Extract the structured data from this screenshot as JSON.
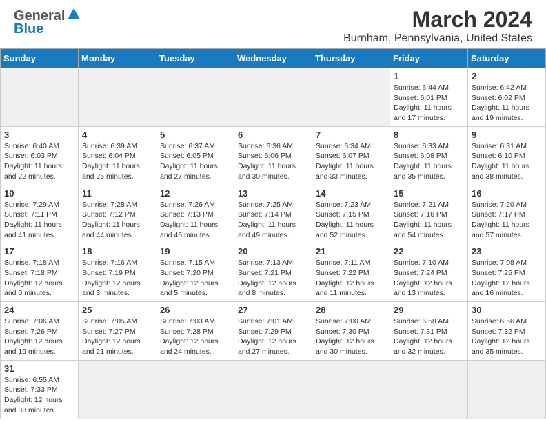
{
  "title": "March 2024",
  "subtitle": "Burnham, Pennsylvania, United States",
  "logo": {
    "text_general": "General",
    "text_blue": "Blue"
  },
  "days_of_week": [
    "Sunday",
    "Monday",
    "Tuesday",
    "Wednesday",
    "Thursday",
    "Friday",
    "Saturday"
  ],
  "weeks": [
    [
      {
        "day": "",
        "detail": ""
      },
      {
        "day": "",
        "detail": ""
      },
      {
        "day": "",
        "detail": ""
      },
      {
        "day": "",
        "detail": ""
      },
      {
        "day": "",
        "detail": ""
      },
      {
        "day": "1",
        "detail": "Sunrise: 6:44 AM\nSunset: 6:01 PM\nDaylight: 11 hours\nand 17 minutes."
      },
      {
        "day": "2",
        "detail": "Sunrise: 6:42 AM\nSunset: 6:02 PM\nDaylight: 11 hours\nand 19 minutes."
      }
    ],
    [
      {
        "day": "3",
        "detail": "Sunrise: 6:40 AM\nSunset: 6:03 PM\nDaylight: 11 hours\nand 22 minutes."
      },
      {
        "day": "4",
        "detail": "Sunrise: 6:39 AM\nSunset: 6:04 PM\nDaylight: 11 hours\nand 25 minutes."
      },
      {
        "day": "5",
        "detail": "Sunrise: 6:37 AM\nSunset: 6:05 PM\nDaylight: 11 hours\nand 27 minutes."
      },
      {
        "day": "6",
        "detail": "Sunrise: 6:36 AM\nSunset: 6:06 PM\nDaylight: 11 hours\nand 30 minutes."
      },
      {
        "day": "7",
        "detail": "Sunrise: 6:34 AM\nSunset: 6:07 PM\nDaylight: 11 hours\nand 33 minutes."
      },
      {
        "day": "8",
        "detail": "Sunrise: 6:33 AM\nSunset: 6:08 PM\nDaylight: 11 hours\nand 35 minutes."
      },
      {
        "day": "9",
        "detail": "Sunrise: 6:31 AM\nSunset: 6:10 PM\nDaylight: 11 hours\nand 38 minutes."
      }
    ],
    [
      {
        "day": "10",
        "detail": "Sunrise: 7:29 AM\nSunset: 7:11 PM\nDaylight: 11 hours\nand 41 minutes."
      },
      {
        "day": "11",
        "detail": "Sunrise: 7:28 AM\nSunset: 7:12 PM\nDaylight: 11 hours\nand 44 minutes."
      },
      {
        "day": "12",
        "detail": "Sunrise: 7:26 AM\nSunset: 7:13 PM\nDaylight: 11 hours\nand 46 minutes."
      },
      {
        "day": "13",
        "detail": "Sunrise: 7:25 AM\nSunset: 7:14 PM\nDaylight: 11 hours\nand 49 minutes."
      },
      {
        "day": "14",
        "detail": "Sunrise: 7:23 AM\nSunset: 7:15 PM\nDaylight: 11 hours\nand 52 minutes."
      },
      {
        "day": "15",
        "detail": "Sunrise: 7:21 AM\nSunset: 7:16 PM\nDaylight: 11 hours\nand 54 minutes."
      },
      {
        "day": "16",
        "detail": "Sunrise: 7:20 AM\nSunset: 7:17 PM\nDaylight: 11 hours\nand 57 minutes."
      }
    ],
    [
      {
        "day": "17",
        "detail": "Sunrise: 7:18 AM\nSunset: 7:18 PM\nDaylight: 12 hours\nand 0 minutes."
      },
      {
        "day": "18",
        "detail": "Sunrise: 7:16 AM\nSunset: 7:19 PM\nDaylight: 12 hours\nand 3 minutes."
      },
      {
        "day": "19",
        "detail": "Sunrise: 7:15 AM\nSunset: 7:20 PM\nDaylight: 12 hours\nand 5 minutes."
      },
      {
        "day": "20",
        "detail": "Sunrise: 7:13 AM\nSunset: 7:21 PM\nDaylight: 12 hours\nand 8 minutes."
      },
      {
        "day": "21",
        "detail": "Sunrise: 7:11 AM\nSunset: 7:22 PM\nDaylight: 12 hours\nand 11 minutes."
      },
      {
        "day": "22",
        "detail": "Sunrise: 7:10 AM\nSunset: 7:24 PM\nDaylight: 12 hours\nand 13 minutes."
      },
      {
        "day": "23",
        "detail": "Sunrise: 7:08 AM\nSunset: 7:25 PM\nDaylight: 12 hours\nand 16 minutes."
      }
    ],
    [
      {
        "day": "24",
        "detail": "Sunrise: 7:06 AM\nSunset: 7:26 PM\nDaylight: 12 hours\nand 19 minutes."
      },
      {
        "day": "25",
        "detail": "Sunrise: 7:05 AM\nSunset: 7:27 PM\nDaylight: 12 hours\nand 21 minutes."
      },
      {
        "day": "26",
        "detail": "Sunrise: 7:03 AM\nSunset: 7:28 PM\nDaylight: 12 hours\nand 24 minutes."
      },
      {
        "day": "27",
        "detail": "Sunrise: 7:01 AM\nSunset: 7:29 PM\nDaylight: 12 hours\nand 27 minutes."
      },
      {
        "day": "28",
        "detail": "Sunrise: 7:00 AM\nSunset: 7:30 PM\nDaylight: 12 hours\nand 30 minutes."
      },
      {
        "day": "29",
        "detail": "Sunrise: 6:58 AM\nSunset: 7:31 PM\nDaylight: 12 hours\nand 32 minutes."
      },
      {
        "day": "30",
        "detail": "Sunrise: 6:56 AM\nSunset: 7:32 PM\nDaylight: 12 hours\nand 35 minutes."
      }
    ],
    [
      {
        "day": "31",
        "detail": "Sunrise: 6:55 AM\nSunset: 7:33 PM\nDaylight: 12 hours\nand 38 minutes."
      },
      {
        "day": "",
        "detail": ""
      },
      {
        "day": "",
        "detail": ""
      },
      {
        "day": "",
        "detail": ""
      },
      {
        "day": "",
        "detail": ""
      },
      {
        "day": "",
        "detail": ""
      },
      {
        "day": "",
        "detail": ""
      }
    ]
  ]
}
